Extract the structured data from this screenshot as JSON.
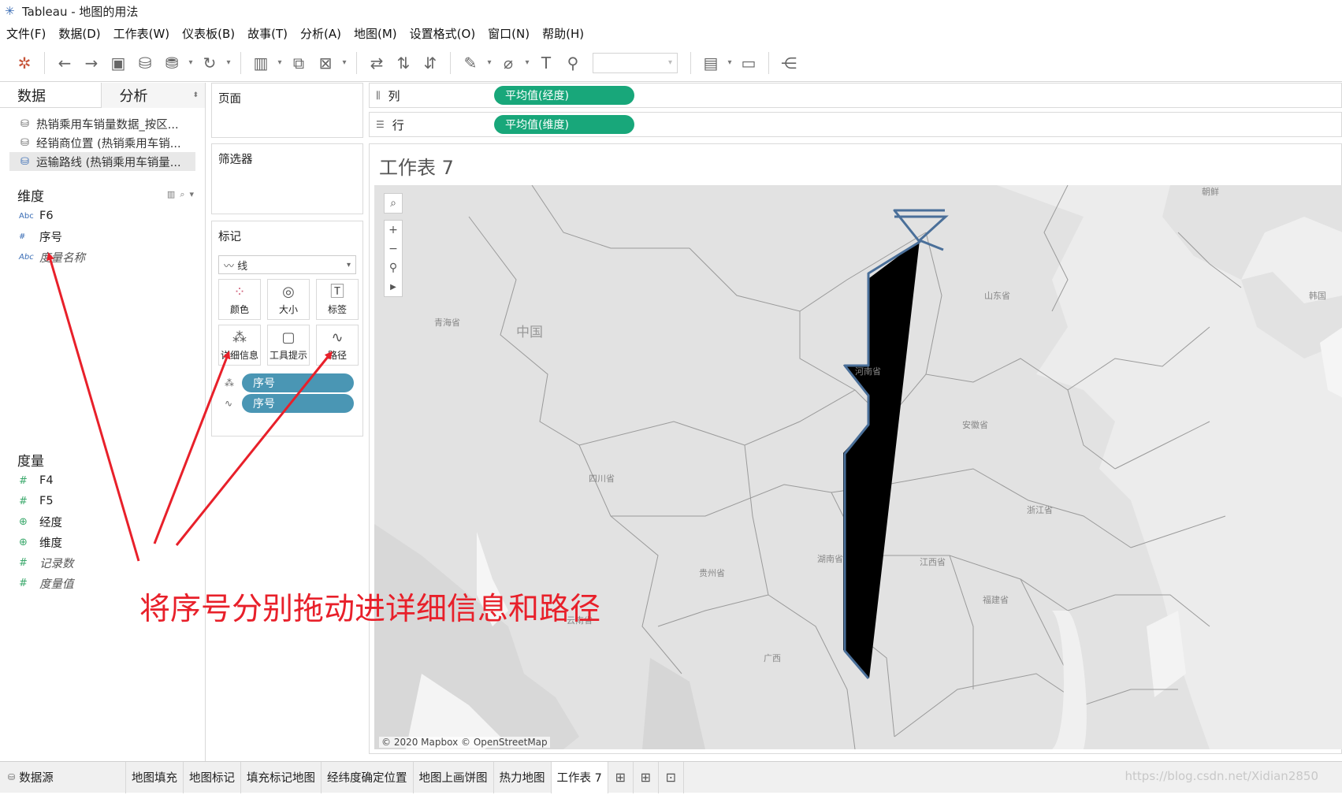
{
  "window": {
    "title": "Tableau - 地图的用法"
  },
  "menu": [
    "文件(F)",
    "数据(D)",
    "工作表(W)",
    "仪表板(B)",
    "故事(T)",
    "分析(A)",
    "地图(M)",
    "设置格式(O)",
    "窗口(N)",
    "帮助(H)"
  ],
  "data_pane": {
    "tab_data": "数据",
    "tab_analysis": "分析",
    "sources": [
      "热销乘用车销量数据_按区...",
      "经销商位置 (热销乘用车销...",
      "运输路线 (热销乘用车销量..."
    ],
    "dimensions_label": "维度",
    "dimensions": [
      {
        "type": "Abc",
        "name": "F6"
      },
      {
        "type": "#",
        "name": "序号"
      },
      {
        "type": "Abc",
        "name": "度量名称"
      }
    ],
    "measures_label": "度量",
    "measures": [
      {
        "type": "#",
        "name": "F4"
      },
      {
        "type": "#",
        "name": "F5"
      },
      {
        "type": "geo",
        "name": "经度"
      },
      {
        "type": "geo",
        "name": "维度"
      },
      {
        "type": "#",
        "name": "记录数"
      },
      {
        "type": "#",
        "name": "度量值"
      }
    ]
  },
  "pages_label": "页面",
  "filters_label": "筛选器",
  "marks": {
    "label": "标记",
    "mark_type": "线",
    "buttons": [
      "颜色",
      "大小",
      "标签",
      "详细信息",
      "工具提示",
      "路径"
    ],
    "pills": [
      "序号",
      "序号"
    ]
  },
  "shelves": {
    "columns_label": "列",
    "columns_pill": "平均值(经度)",
    "rows_label": "行",
    "rows_pill": "平均值(维度)"
  },
  "view": {
    "title": "工作表 7",
    "attribution": "© 2020 Mapbox © OpenStreetMap",
    "labels": [
      "中国",
      "青海省",
      "四川省",
      "云南省",
      "贵州省",
      "广西",
      "湖南省",
      "河南省",
      "山东省",
      "安徽省",
      "浙江省",
      "江西省",
      "福建省",
      "韩国",
      "朝鲜"
    ]
  },
  "annotation": "将序号分别拖动进详细信息和路径",
  "sheet_tabs": [
    "数据源",
    "地图填充",
    "地图标记",
    "填充标记地图",
    "经纬度确定位置",
    "地图上画饼图",
    "热力地图",
    "工作表 7"
  ],
  "watermark": "https://blog.csdn.net/Xidian2850",
  "colors": {
    "route": "#4a6f99",
    "measure_pill": "#18a77a",
    "dimension_pill": "#4a96b4",
    "annotation": "#e8202a"
  }
}
